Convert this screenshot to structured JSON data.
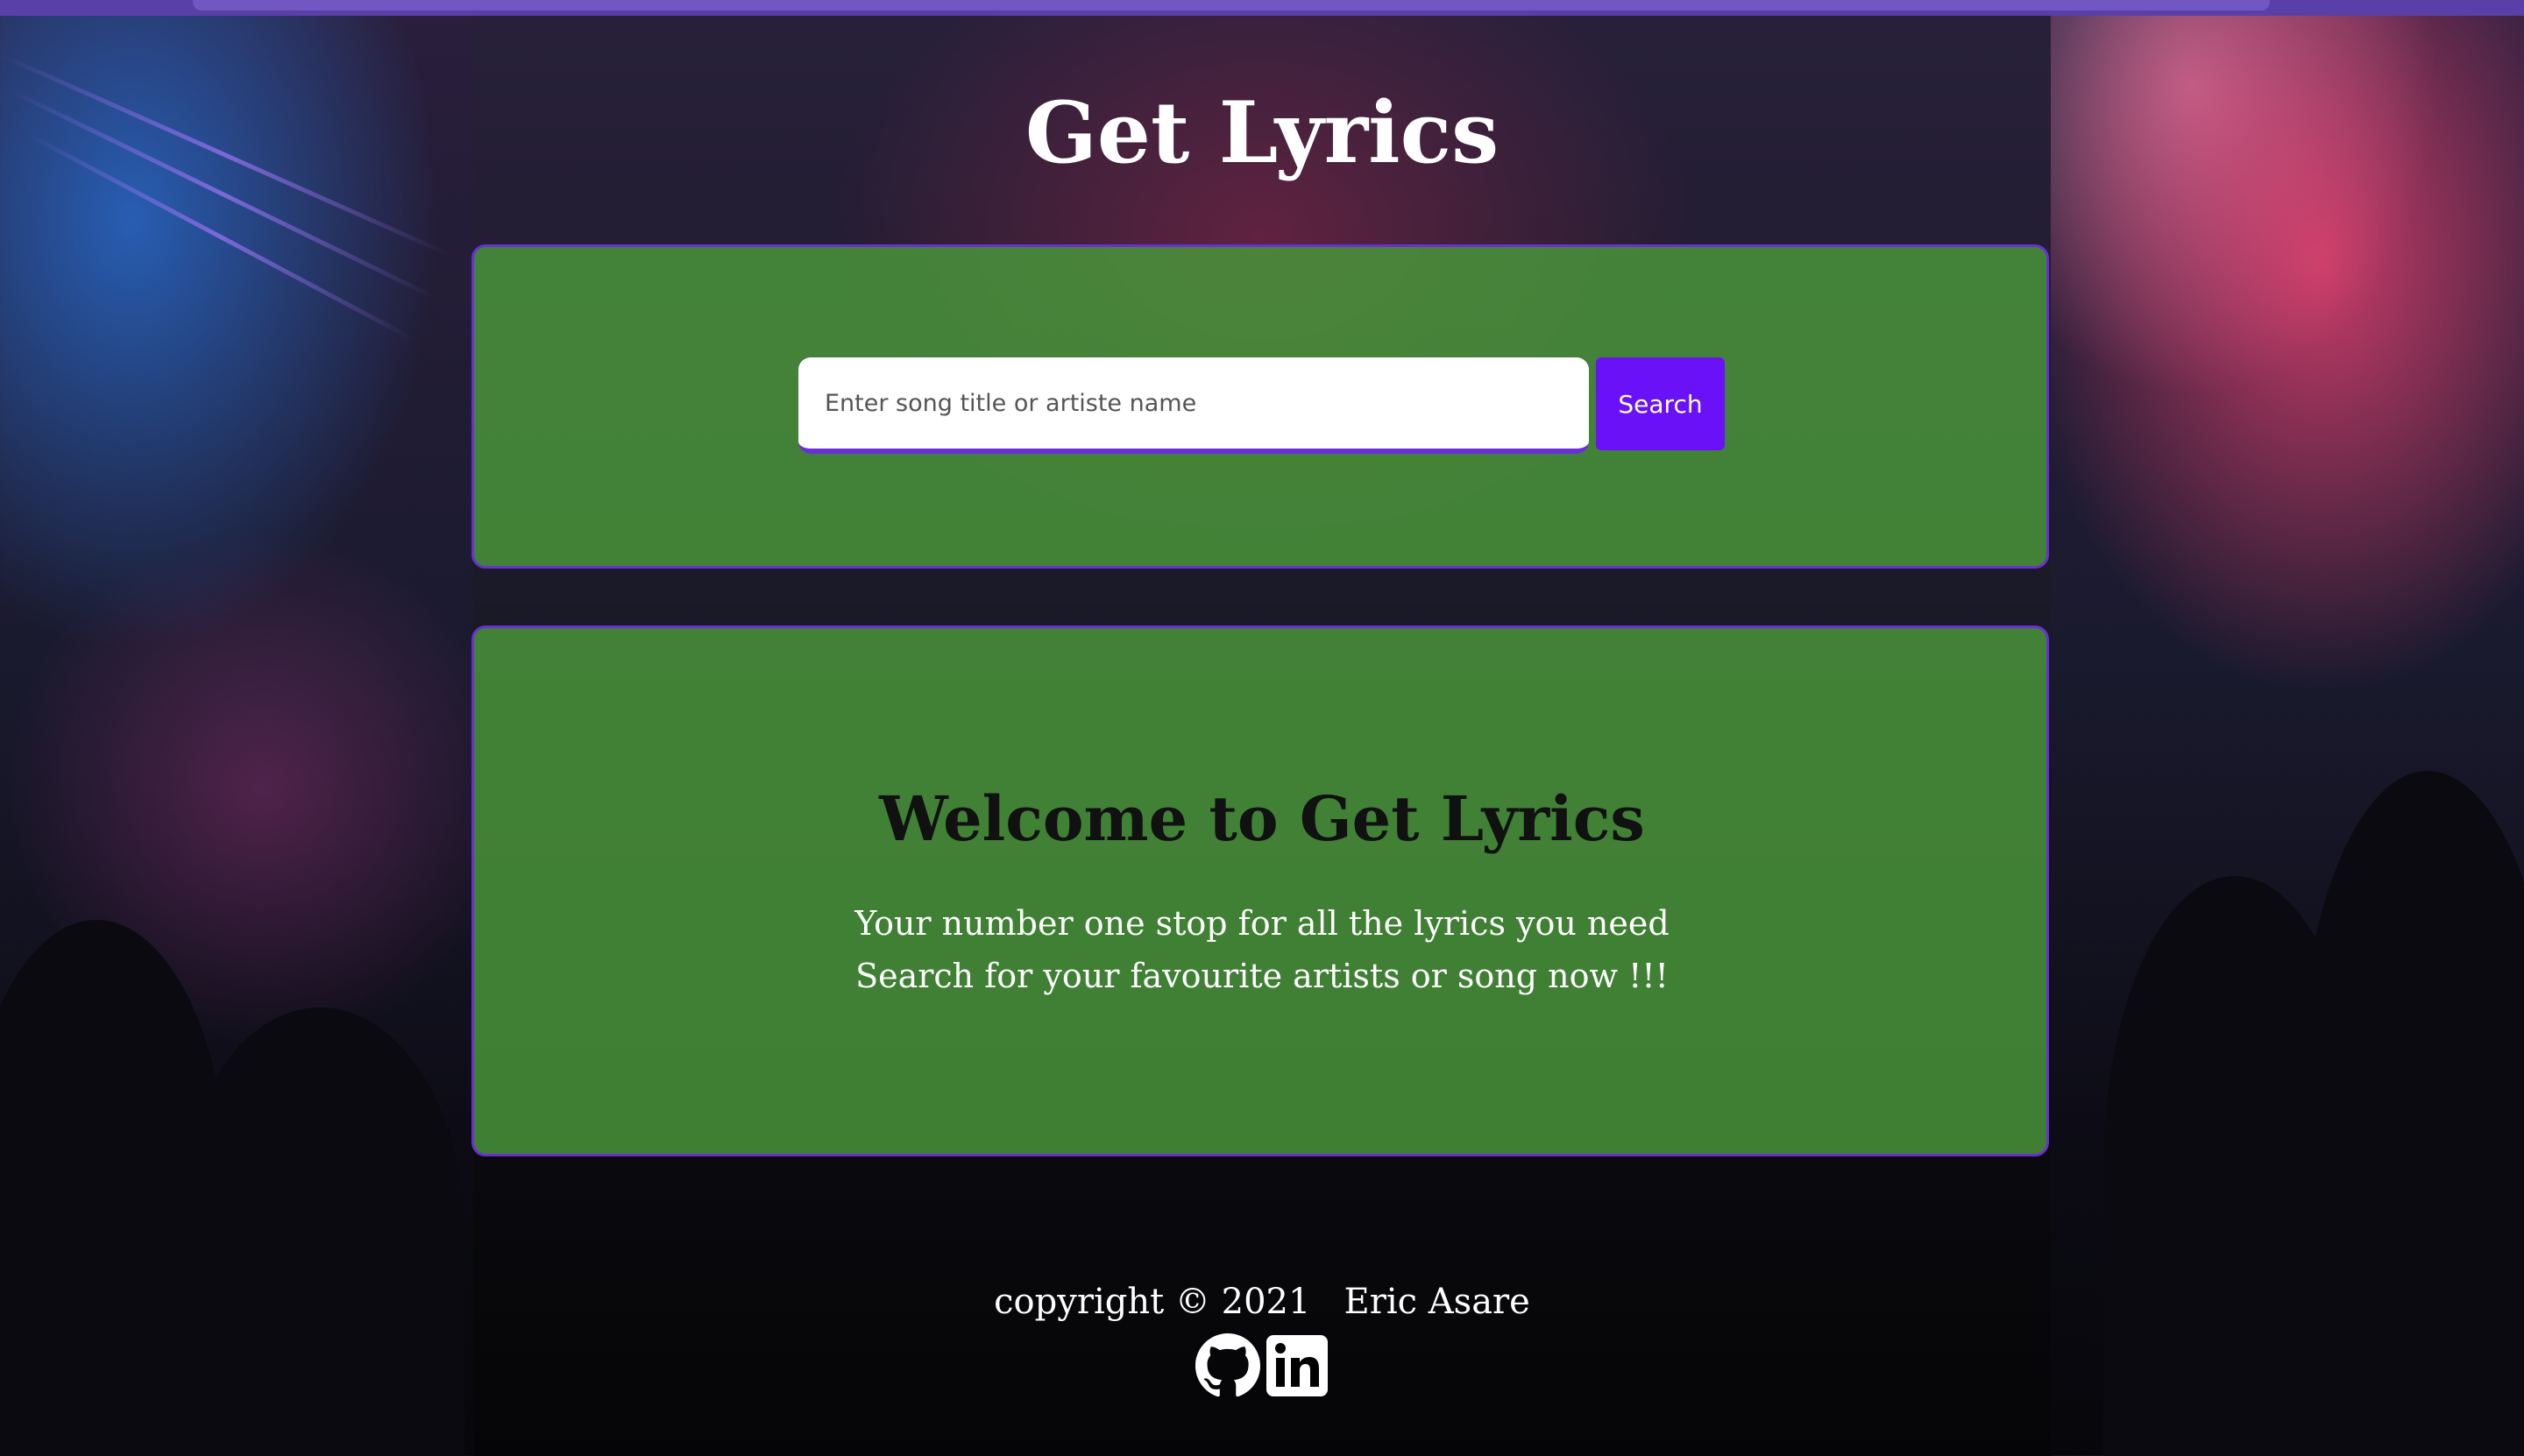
{
  "header": {
    "title": "Get Lyrics"
  },
  "search": {
    "placeholder": "Enter song title or artiste name",
    "value": "",
    "button_label": "Search"
  },
  "welcome": {
    "heading": "Welcome to Get Lyrics",
    "line_1": "Your number one stop for all the lyrics you need",
    "line_2": "Search for your favourite artists or song now !!!"
  },
  "footer": {
    "copyright": "copyright © 2021   Eric Asare",
    "icons": [
      "github-icon",
      "linkedin-icon"
    ]
  },
  "colors": {
    "accent": "#6a11f7",
    "panel_green": "#4a963a",
    "panel_border": "#6a2fd6"
  }
}
